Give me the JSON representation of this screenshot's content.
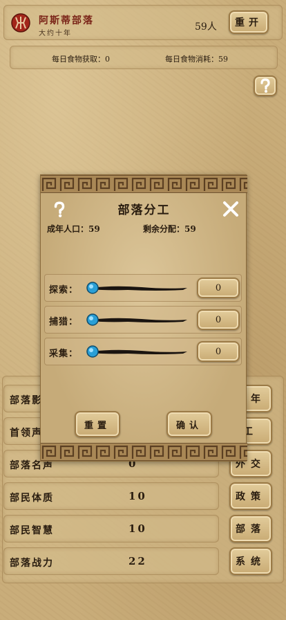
{
  "header": {
    "tribe_name": "阿斯蒂部落",
    "tribe_age": "大约十年",
    "population": "59人",
    "restart_label": "重开"
  },
  "food": {
    "daily_gain": "每日食物获取：0",
    "daily_cost": "每日食物消耗：59"
  },
  "stats": [
    {
      "label": "部落影",
      "value": ""
    },
    {
      "label": "首领声",
      "value": ""
    },
    {
      "label": "部落名声",
      "value": "0"
    },
    {
      "label": "部民体质",
      "value": "10"
    },
    {
      "label": "部民智慧",
      "value": "10"
    },
    {
      "label": "部落战力",
      "value": "22"
    }
  ],
  "side_buttons": [
    "一年",
    "工",
    "外交",
    "政策",
    "部落",
    "系统"
  ],
  "modal": {
    "title": "部落分工",
    "adult_population": "成年人口：59",
    "remaining": "剩余分配：59",
    "jobs": [
      {
        "label": "探索：",
        "value": "0",
        "fraction": 0
      },
      {
        "label": "捕猎：",
        "value": "0",
        "fraction": 0
      },
      {
        "label": "采集：",
        "value": "0",
        "fraction": 0
      }
    ],
    "reset_label": "重置",
    "confirm_label": "确认"
  },
  "icons": {
    "emblem": "horde-emblem-icon",
    "help": "question-mark-icon",
    "close": "close-x-icon",
    "slider_knob": "blue-orb-icon"
  },
  "colors": {
    "parchment": "#c9ad7a",
    "emblem_red": "#a3261a",
    "knob_blue": "#2a9fd6",
    "text_dark": "#2a1d10"
  }
}
